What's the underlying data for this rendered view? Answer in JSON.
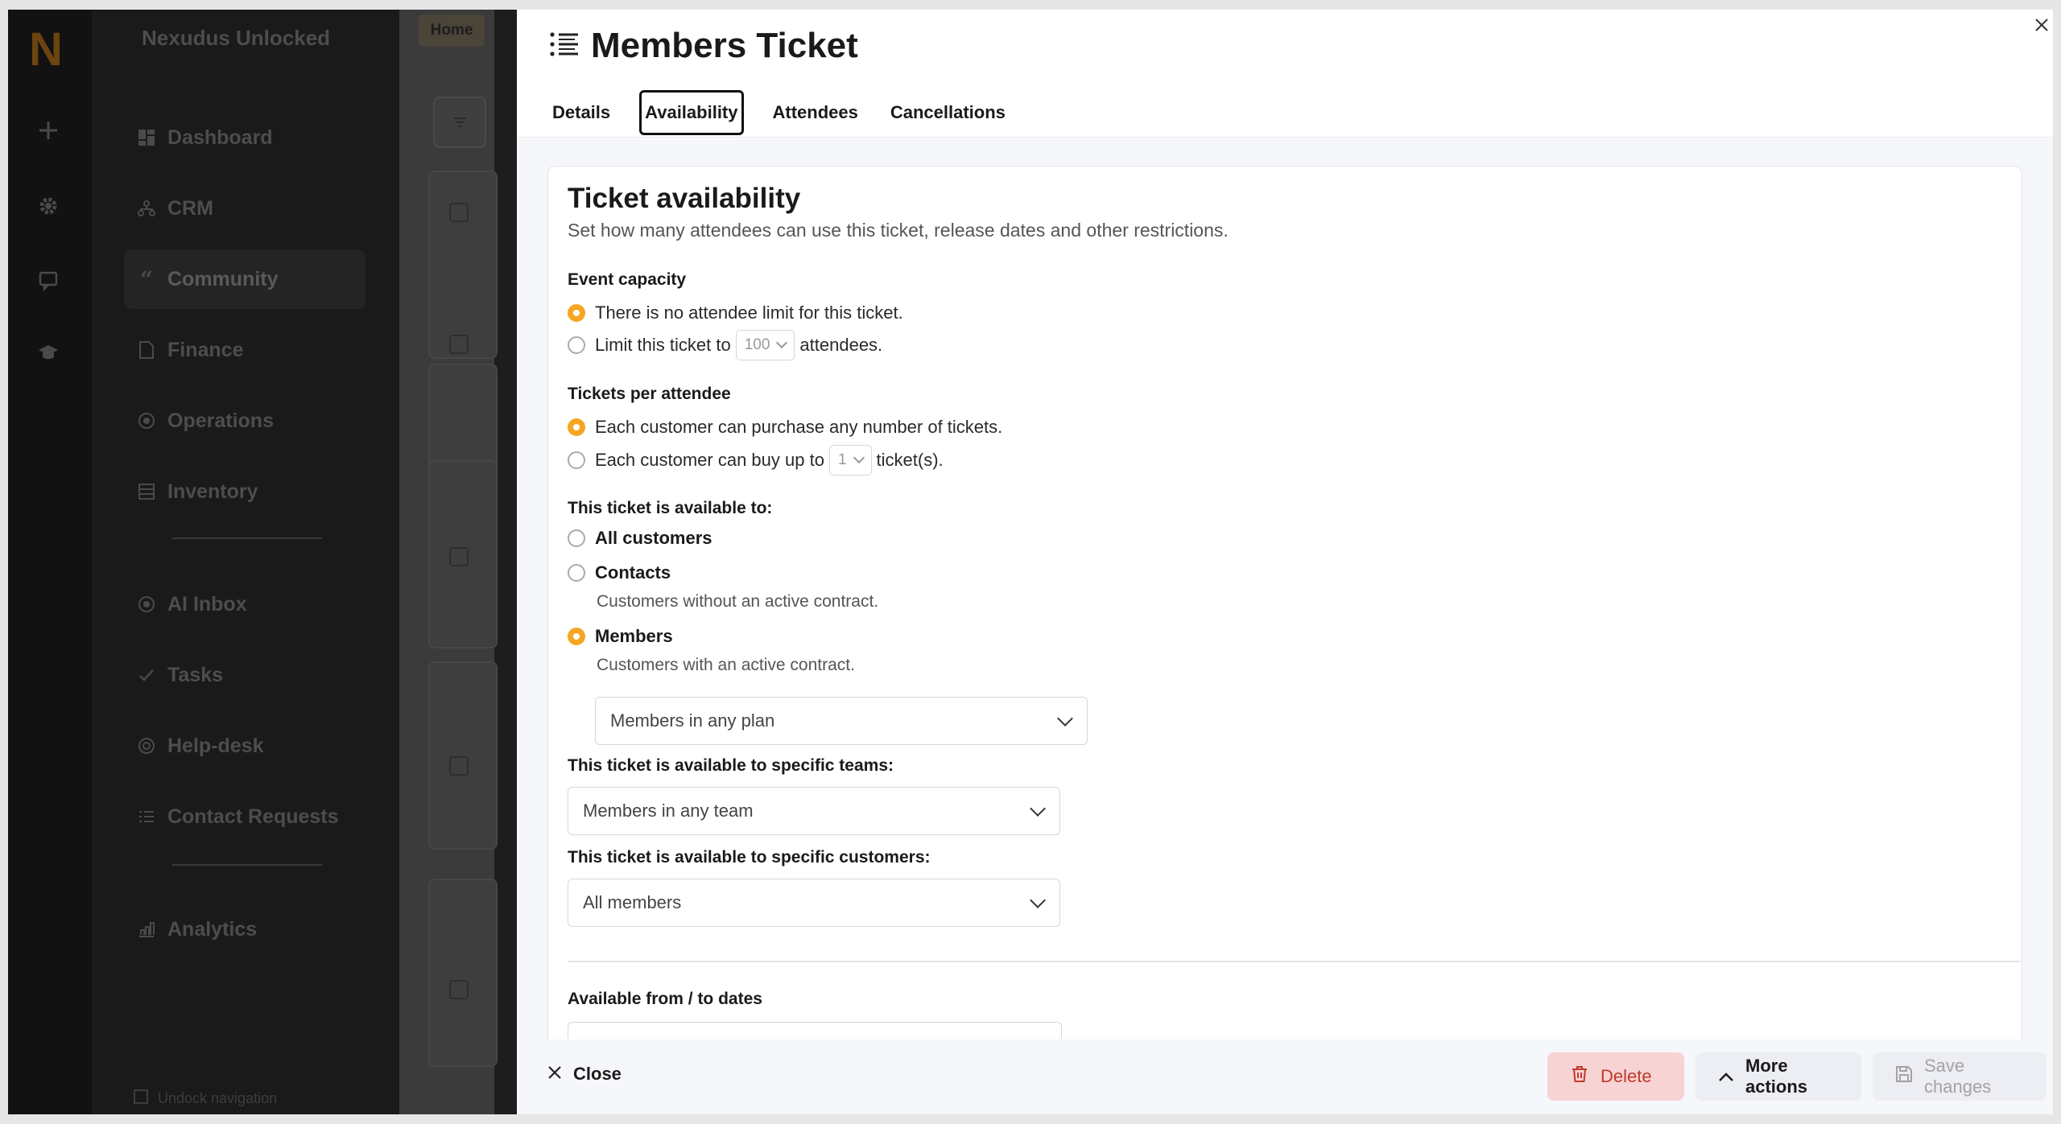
{
  "rail": {
    "logo": "N",
    "icons": [
      "plus-icon",
      "gear-icon",
      "chat-icon",
      "graduation-cap-icon"
    ]
  },
  "sidebar": {
    "brand": "Nexudus Unlocked",
    "items": [
      {
        "label": "Dashboard",
        "icon": "dashboard-icon"
      },
      {
        "label": "CRM",
        "icon": "crm-icon"
      },
      {
        "label": "Community",
        "icon": "quote-icon",
        "active": true
      },
      {
        "label": "Finance",
        "icon": "document-icon"
      },
      {
        "label": "Operations",
        "icon": "operations-icon"
      },
      {
        "label": "Inventory",
        "icon": "inventory-icon"
      },
      {
        "label": "AI Inbox",
        "icon": "ai-inbox-icon"
      },
      {
        "label": "Tasks",
        "icon": "check-icon"
      },
      {
        "label": "Help-desk",
        "icon": "lifebuoy-icon"
      },
      {
        "label": "Contact Requests",
        "icon": "list-icon"
      },
      {
        "label": "Analytics",
        "icon": "chart-icon"
      }
    ],
    "undock_label": "Undock navigation"
  },
  "background": {
    "breadcrumb_home": "Home"
  },
  "drawer": {
    "title": "Members Ticket",
    "tabs": [
      {
        "label": "Details"
      },
      {
        "label": "Availability",
        "active": true
      },
      {
        "label": "Attendees"
      },
      {
        "label": "Cancellations"
      }
    ],
    "card": {
      "title": "Ticket availability",
      "subtitle": "Set how many attendees can use this ticket, release dates and other restrictions.",
      "event_capacity": {
        "label": "Event capacity",
        "option_no_limit": "There is no attendee limit for this ticket.",
        "option_limit_prefix": "Limit this ticket to",
        "option_limit_value": "100",
        "option_limit_suffix": "attendees.",
        "selected": "no_limit"
      },
      "tickets_per_attendee": {
        "label": "Tickets per attendee",
        "option_any": "Each customer can purchase any number of tickets.",
        "option_limit_prefix": "Each customer can buy up to",
        "option_limit_value": "1",
        "option_limit_suffix": "ticket(s).",
        "selected": "any"
      },
      "available_to": {
        "label": "This ticket is available to:",
        "all_customers": "All customers",
        "contacts": "Contacts",
        "contacts_hint": "Customers without an active contract.",
        "members": "Members",
        "members_hint": "Customers with an active contract.",
        "selected": "members",
        "plan_select": "Members in any plan"
      },
      "teams": {
        "label": "This ticket is available to specific teams:",
        "value": "Members in any team"
      },
      "customers": {
        "label": "This ticket is available to specific customers:",
        "value": "All members"
      },
      "dates": {
        "label": "Available from / to dates"
      }
    },
    "footer": {
      "close": "Close",
      "delete": "Delete",
      "more_actions": "More actions",
      "save_changes": "Save changes"
    }
  },
  "colors": {
    "accent": "#f5a623",
    "danger": "#c0392b",
    "danger_bg": "#f7d3d3"
  }
}
